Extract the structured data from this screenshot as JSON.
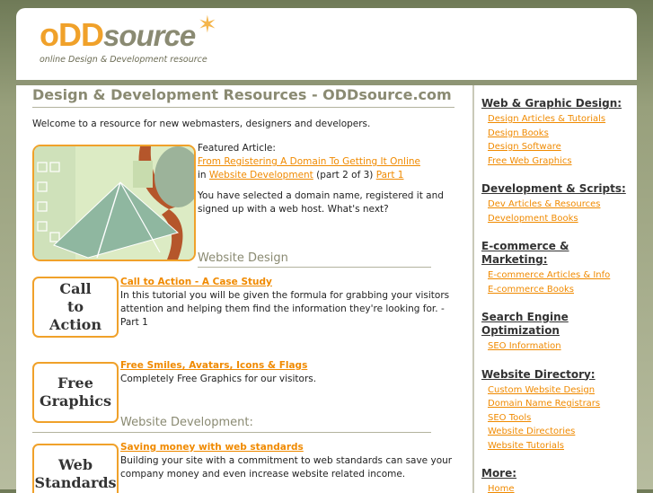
{
  "logo": {
    "odd": "oDD",
    "source": "source",
    "tagline": "online Design & Development resource"
  },
  "main": {
    "title": "Design & Development Resources - ODDsource.com",
    "welcome": "Welcome to a resource for new webmasters, designers and developers.",
    "featured": {
      "label": "Featured Article:",
      "link": "From Registering A Domain To Getting It Online",
      "in_text": "in",
      "category_link": "Website Development",
      "part_text": "(part 2 of 3)",
      "part_link": "Part 1",
      "summary": "You have selected a domain name, registered it and signed up with a web host. What's next?"
    },
    "sections": [
      {
        "heading": "Website Design",
        "items": [
          {
            "thumb_line1": "Call",
            "thumb_line2": "to",
            "thumb_line3": "Action",
            "title": "Call to Action - A Case Study",
            "text": "In this tutorial you will be given the formula for grabbing your visitors attention and helping them find the information they're looking for. - Part 1"
          },
          {
            "thumb_line1": "Free",
            "thumb_line2": "Graphics",
            "title": "Free Smiles, Avatars, Icons & Flags",
            "text": "Completely Free Graphics for our visitors."
          }
        ]
      },
      {
        "heading": "Website Development:",
        "items": [
          {
            "thumb_line1": "Web",
            "thumb_line2": "Standards",
            "title": "Saving money with web standards",
            "text": "Building your site with a commitment to web standards can save your company money and even increase website related income."
          }
        ]
      }
    ]
  },
  "sidebar": {
    "groups": [
      {
        "heading": "Web & Graphic Design:",
        "links": [
          "Design Articles & Tutorials",
          "Design Books",
          "Design Software",
          "Free Web Graphics"
        ]
      },
      {
        "heading": "Development & Scripts:",
        "links": [
          "Dev Articles & Resources",
          "Development Books"
        ]
      },
      {
        "heading": "E-commerce & Marketing:",
        "links": [
          "E-commerce Articles & Info",
          "E-commerce Books"
        ]
      },
      {
        "heading": "Search Engine Optimization",
        "links": [
          "SEO Information"
        ]
      },
      {
        "heading": "Website Directory:",
        "links": [
          "Custom Website Design",
          "Domain Name Registrars",
          "SEO Tools",
          "Website Directories",
          "Website Tutorials"
        ]
      },
      {
        "heading": "More:",
        "links": [
          "Home"
        ]
      }
    ]
  },
  "colors": {
    "accent": "#f08a00",
    "orange_border": "#f0a12a",
    "heading_gray": "#8a8a72",
    "background_olive": "#98a07c"
  }
}
